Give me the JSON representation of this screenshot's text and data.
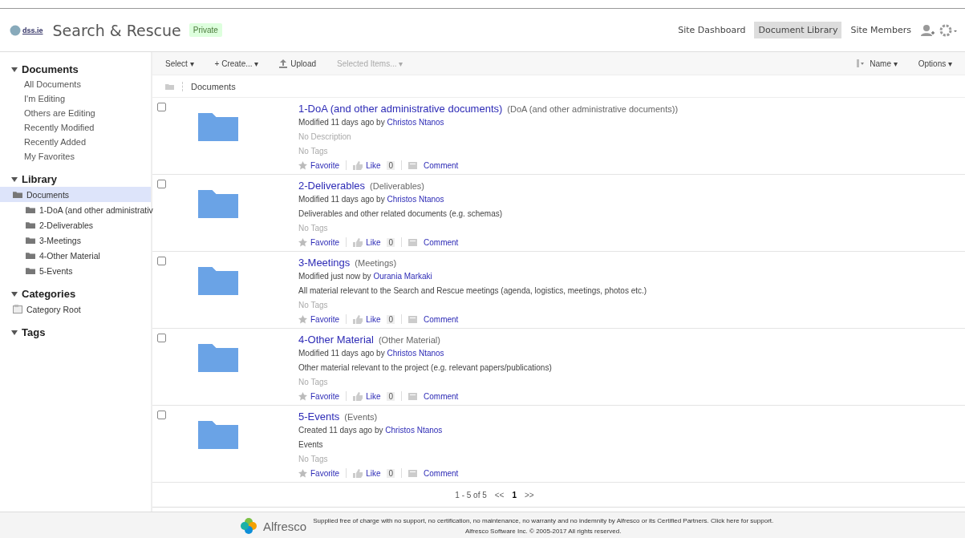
{
  "header": {
    "logo_text": "dss.ie",
    "title": "Search & Rescue",
    "badge": "Private",
    "nav": [
      {
        "label": "Site Dashboard",
        "selected": false
      },
      {
        "label": "Document Library",
        "selected": true
      },
      {
        "label": "Site Members",
        "selected": false
      }
    ]
  },
  "sidebar": {
    "sections": [
      {
        "kind": "list",
        "title": "Documents",
        "expanded": true,
        "items": [
          "All Documents",
          "I'm Editing",
          "Others are Editing",
          "Recently Modified",
          "Recently Added",
          "My Favorites"
        ]
      },
      {
        "kind": "tree",
        "title": "Library",
        "expanded": true,
        "tree": [
          {
            "label": "Documents",
            "selected": true,
            "children": [
              {
                "label": "1-DoA (and other administrativ",
                "selected": false
              },
              {
                "label": "2-Deliverables",
                "selected": false
              },
              {
                "label": "3-Meetings",
                "selected": false
              },
              {
                "label": "4-Other Material",
                "selected": false
              },
              {
                "label": "5-Events",
                "selected": false
              }
            ]
          }
        ]
      },
      {
        "kind": "category",
        "title": "Categories",
        "expanded": true,
        "items": [
          "Category Root"
        ]
      },
      {
        "kind": "list",
        "title": "Tags",
        "expanded": true
      }
    ]
  },
  "toolbar": {
    "left": [
      {
        "label": "Select ▾",
        "kind": "menu",
        "disabled": false
      },
      {
        "label": "+ Create... ▾",
        "kind": "menu",
        "disabled": false
      },
      {
        "label": "Upload",
        "kind": "upload",
        "disabled": false
      },
      {
        "label": "Selected Items... ▾",
        "kind": "menu",
        "disabled": true
      }
    ],
    "sort": "Name ▾",
    "options": "Options ▾"
  },
  "breadcrumb": "Documents",
  "rows": [
    {
      "title": "1-DoA (and other administrative documents)",
      "subtitle": "(DoA (and other administrative documents))",
      "action": "Modified 11 days ago by",
      "user": "Christos Ntanos",
      "description": "No Description",
      "description_muted": true,
      "tags": "No Tags",
      "checked": false,
      "favorite": "Favorite",
      "like": "Like",
      "likes": "0",
      "comment": "Comment"
    },
    {
      "title": "2-Deliverables",
      "subtitle": "(Deliverables)",
      "action": "Modified 11 days ago by",
      "user": "Christos Ntanos",
      "description": "Deliverables and other related documents (e.g. schemas)",
      "description_muted": false,
      "tags": "No Tags",
      "checked": false,
      "favorite": "Favorite",
      "like": "Like",
      "likes": "0",
      "comment": "Comment"
    },
    {
      "title": "3-Meetings",
      "subtitle": "(Meetings)",
      "action": "Modified just now by",
      "user": "Ourania Markaki",
      "description": "All material relevant to the Search and Rescue meetings (agenda, logistics, meetings, photos etc.)",
      "description_muted": false,
      "tags": "No Tags",
      "checked": false,
      "favorite": "Favorite",
      "like": "Like",
      "likes": "0",
      "comment": "Comment"
    },
    {
      "title": "4-Other Material",
      "subtitle": "(Other Material)",
      "action": "Modified 11 days ago by",
      "user": "Christos Ntanos",
      "description": "Other material relevant to the project (e.g. relevant papers/publications)",
      "description_muted": false,
      "tags": "No Tags",
      "checked": false,
      "favorite": "Favorite",
      "like": "Like",
      "likes": "0",
      "comment": "Comment"
    },
    {
      "title": "5-Events",
      "subtitle": "(Events)",
      "action": "Created 11 days ago by",
      "user": "Christos Ntanos",
      "description": "Events",
      "description_muted": false,
      "tags": "No Tags",
      "checked": false,
      "favorite": "Favorite",
      "like": "Like",
      "likes": "0",
      "comment": "Comment"
    }
  ],
  "pagination": {
    "range": "1 - 5 of 5",
    "prev": "<<",
    "pages": [
      {
        "label": "1",
        "selected": true
      }
    ],
    "next": ">>"
  },
  "footer": {
    "brand": "Alfresco",
    "notice": "Supplied free of charge with no support, no certification, no maintenance, no warranty and no indemnity by Alfresco or its Certified Partners. Click here for support.",
    "copyright": "Alfresco Software Inc. © 2005-2017 All rights reserved."
  }
}
